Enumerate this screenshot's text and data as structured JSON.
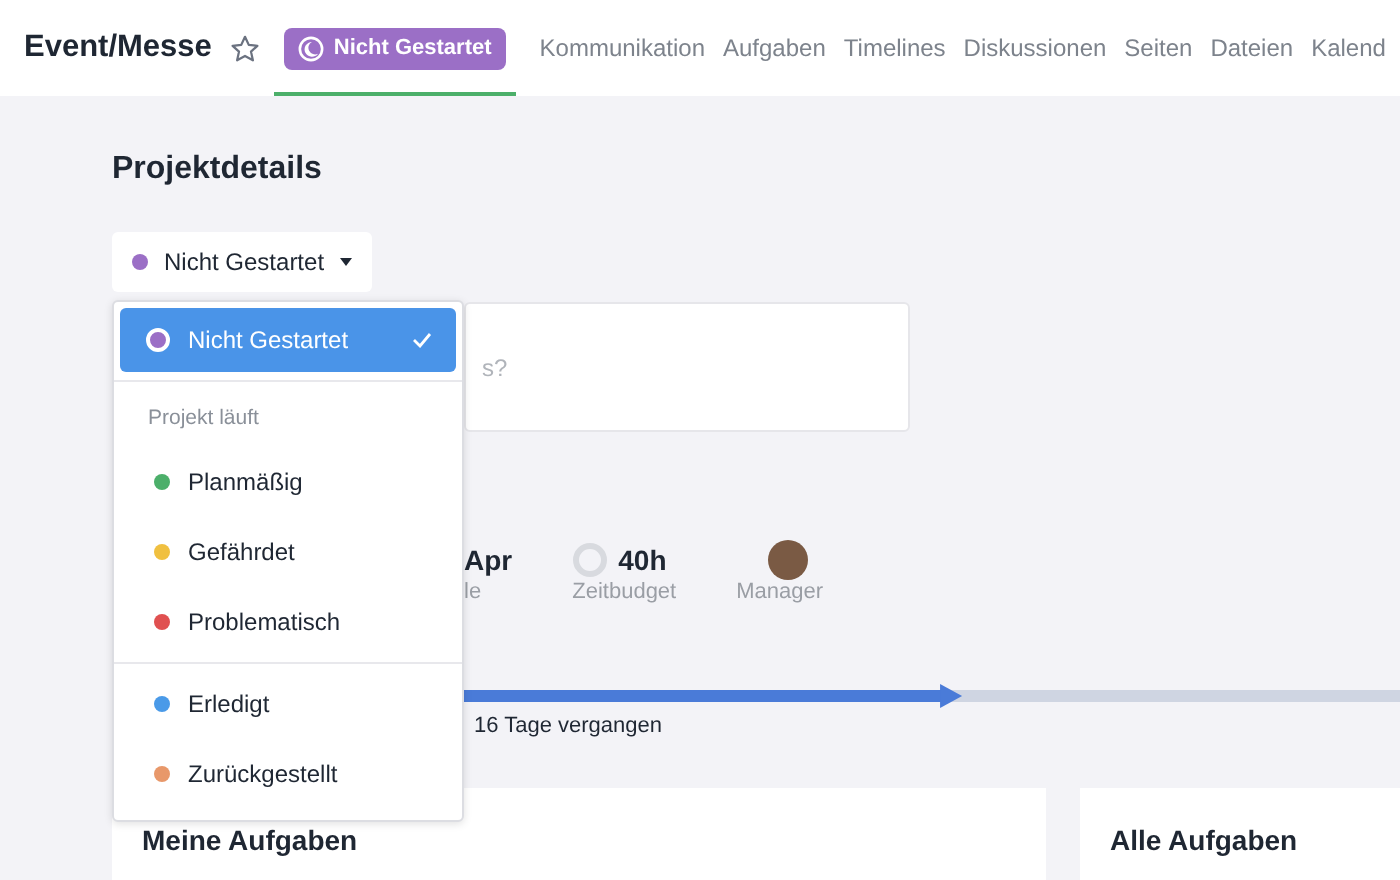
{
  "header": {
    "title": "Event/Messe",
    "starred": false,
    "status_badge": {
      "label": "Nicht Gestartet",
      "color": "#9b6fc6",
      "selected": true
    },
    "tabs": [
      {
        "label": "Kommunikation"
      },
      {
        "label": "Aufgaben"
      },
      {
        "label": "Timelines"
      },
      {
        "label": "Diskussionen"
      },
      {
        "label": "Seiten"
      },
      {
        "label": "Dateien"
      },
      {
        "label": "Kalend"
      }
    ]
  },
  "page": {
    "title": "Projektdetails",
    "status_button": {
      "label": "Nicht Gestartet",
      "color": "#9b6fc6"
    },
    "description": {
      "placeholder": "s?"
    },
    "facts": [
      {
        "kind": "date",
        "value": "Apr",
        "label": "le"
      },
      {
        "kind": "ring",
        "value": "40h",
        "label": "Zeitbudget"
      },
      {
        "kind": "avatar",
        "label": "Manager"
      }
    ],
    "timeline": {
      "level": 0.66,
      "caption": "16 Tage vergangen"
    },
    "cards": [
      {
        "title": "Meine Aufgaben"
      },
      {
        "title": "Alle Aufgaben"
      }
    ]
  },
  "status_menu": {
    "groups": [
      {
        "options": [
          {
            "label": "Nicht Gestartet",
            "color": "#9b6fc6",
            "selected": true
          }
        ]
      },
      {
        "heading": "Projekt läuft",
        "options": [
          {
            "label": "Planmäßig",
            "color": "#4caf6a",
            "selected": false
          },
          {
            "label": "Gefährdet",
            "color": "#f0c040",
            "selected": false
          },
          {
            "label": "Problematisch",
            "color": "#e05050",
            "selected": false
          }
        ]
      },
      {
        "options": [
          {
            "label": "Erledigt",
            "color": "#4a9ae8",
            "selected": false
          },
          {
            "label": "Zurückgestellt",
            "color": "#e8986a",
            "selected": false
          }
        ]
      }
    ]
  }
}
